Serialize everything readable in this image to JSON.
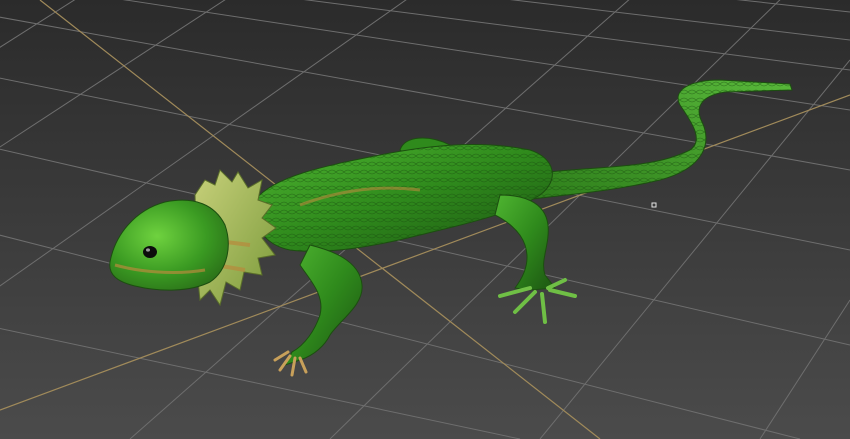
{
  "viewport": {
    "kind": "3d-perspective-viewport",
    "model": "lizard-model",
    "colors": {
      "background_top": "#2c2c2c",
      "background_bottom": "#4c4c4c",
      "grid_line": "#707070",
      "grid_axis": "#a08a5a",
      "skin_dark": "#1e5a12",
      "skin_mid": "#2f8a1c",
      "skin_light": "#5cc43a",
      "skin_accent": "#b88a3c",
      "frill": "#a8b85a"
    }
  }
}
